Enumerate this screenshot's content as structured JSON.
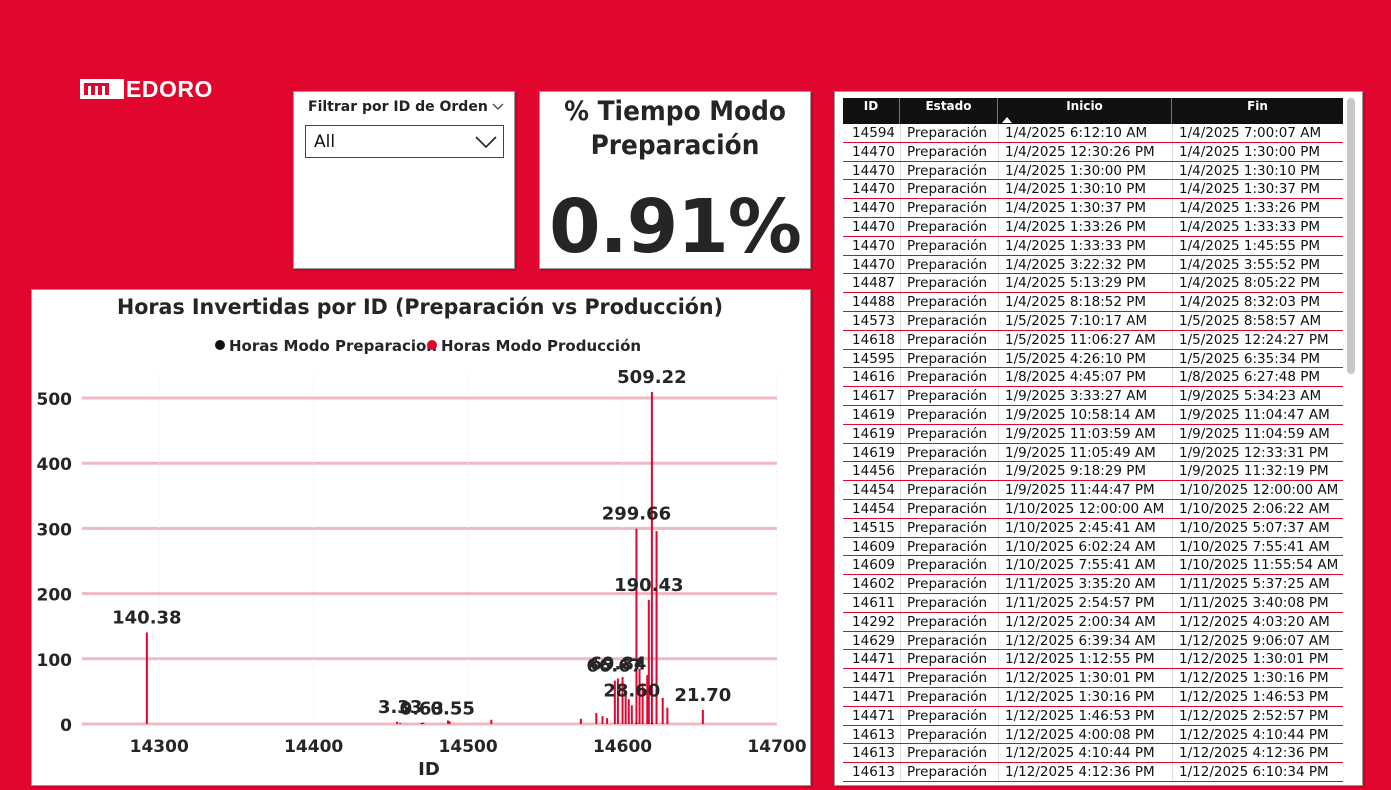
{
  "brand": {
    "logo_text": "EDORO"
  },
  "slicer": {
    "title": "Filtrar por ID de Orden",
    "selected": "All"
  },
  "kpi": {
    "title_line1": "% Tiempo Modo",
    "title_line2": "Preparación",
    "value": "0.91%"
  },
  "colors": {
    "background": "#E1062D",
    "series_prep": "#111111",
    "series_prod": "#E1062D",
    "grid": "#F0B8C2"
  },
  "chart_data": {
    "type": "bar",
    "title": "Horas Invertidas por ID (Preparación vs Producción)",
    "xlabel": "ID",
    "ylabel": "",
    "xlim": [
      14250,
      14700
    ],
    "ylim": [
      0,
      520
    ],
    "xticks": [
      14300,
      14400,
      14500,
      14600,
      14700
    ],
    "yticks": [
      0,
      100,
      200,
      300,
      400,
      500
    ],
    "grid": "horizontal",
    "legend_position": "top-center",
    "series": [
      {
        "name": "Horas Modo Preparacion",
        "color": "#111111",
        "x": [
          14470,
          14609,
          14619
        ],
        "values": [
          0.5,
          0.8,
          0.6
        ]
      },
      {
        "name": "Horas Modo Producción",
        "color": "#E1062D",
        "x": [
          14292,
          14454,
          14456,
          14470,
          14471,
          14487,
          14488,
          14515,
          14573,
          14583,
          14587,
          14590,
          14595,
          14597,
          14600,
          14602,
          14604,
          14606,
          14609,
          14611,
          14613,
          14616,
          14617,
          14619,
          14622,
          14626,
          14629,
          14652
        ],
        "values": [
          140.38,
          3.33,
          0.63,
          0.55,
          2.1,
          5.4,
          4.2,
          6.5,
          8.0,
          17.0,
          12.0,
          9.0,
          66.67,
          69.84,
          72.0,
          50.0,
          38.0,
          28.6,
          299.66,
          85.0,
          60.0,
          75.0,
          190.43,
          509.22,
          296.0,
          40.0,
          25.0,
          21.7
        ]
      }
    ],
    "data_labels": [
      {
        "x": 14292,
        "y": 140.38,
        "text": "140.38"
      },
      {
        "x": 14456,
        "y": 3.33,
        "text": "3.33"
      },
      {
        "x": 14470,
        "y": 0.63,
        "text": "0.63"
      },
      {
        "x": 14490,
        "y": 0.55,
        "text": "0.55"
      },
      {
        "x": 14595,
        "y": 66.67,
        "text": "66.67"
      },
      {
        "x": 14597,
        "y": 69.84,
        "text": "69.84"
      },
      {
        "x": 14606,
        "y": 28.6,
        "text": "28.60"
      },
      {
        "x": 14609,
        "y": 299.66,
        "text": "299.66"
      },
      {
        "x": 14617,
        "y": 190.43,
        "text": "190.43"
      },
      {
        "x": 14619,
        "y": 509.22,
        "text": "509.22"
      },
      {
        "x": 14652,
        "y": 21.7,
        "text": "21.70"
      }
    ]
  },
  "table": {
    "columns": [
      "ID",
      "Estado",
      "Inicio",
      "Fin"
    ],
    "rows": [
      [
        "14594",
        "Preparación",
        "1/4/2025 6:12:10 AM",
        "1/4/2025 7:00:07 AM"
      ],
      [
        "14470",
        "Preparación",
        "1/4/2025 12:30:26 PM",
        "1/4/2025 1:30:00 PM"
      ],
      [
        "14470",
        "Preparación",
        "1/4/2025 1:30:00 PM",
        "1/4/2025 1:30:10 PM"
      ],
      [
        "14470",
        "Preparación",
        "1/4/2025 1:30:10 PM",
        "1/4/2025 1:30:37 PM"
      ],
      [
        "14470",
        "Preparación",
        "1/4/2025 1:30:37 PM",
        "1/4/2025 1:33:26 PM"
      ],
      [
        "14470",
        "Preparación",
        "1/4/2025 1:33:26 PM",
        "1/4/2025 1:33:33 PM"
      ],
      [
        "14470",
        "Preparación",
        "1/4/2025 1:33:33 PM",
        "1/4/2025 1:45:55 PM"
      ],
      [
        "14470",
        "Preparación",
        "1/4/2025 3:22:32 PM",
        "1/4/2025 3:55:52 PM"
      ],
      [
        "14487",
        "Preparación",
        "1/4/2025 5:13:29 PM",
        "1/4/2025 8:05:22 PM"
      ],
      [
        "14488",
        "Preparación",
        "1/4/2025 8:18:52 PM",
        "1/4/2025 8:32:03 PM"
      ],
      [
        "14573",
        "Preparación",
        "1/5/2025 7:10:17 AM",
        "1/5/2025 8:58:57 AM"
      ],
      [
        "14618",
        "Preparación",
        "1/5/2025 11:06:27 AM",
        "1/5/2025 12:24:27 PM"
      ],
      [
        "14595",
        "Preparación",
        "1/5/2025 4:26:10 PM",
        "1/5/2025 6:35:34 PM"
      ],
      [
        "14616",
        "Preparación",
        "1/8/2025 4:45:07 PM",
        "1/8/2025 6:27:48 PM"
      ],
      [
        "14617",
        "Preparación",
        "1/9/2025 3:33:27 AM",
        "1/9/2025 5:34:23 AM"
      ],
      [
        "14619",
        "Preparación",
        "1/9/2025 10:58:14 AM",
        "1/9/2025 11:04:47 AM"
      ],
      [
        "14619",
        "Preparación",
        "1/9/2025 11:03:59 AM",
        "1/9/2025 11:04:59 AM"
      ],
      [
        "14619",
        "Preparación",
        "1/9/2025 11:05:49 AM",
        "1/9/2025 12:33:31 PM"
      ],
      [
        "14456",
        "Preparación",
        "1/9/2025 9:18:29 PM",
        "1/9/2025 11:32:19 PM"
      ],
      [
        "14454",
        "Preparación",
        "1/9/2025 11:44:47 PM",
        "1/10/2025 12:00:00 AM"
      ],
      [
        "14454",
        "Preparación",
        "1/10/2025 12:00:00 AM",
        "1/10/2025 2:06:22 AM"
      ],
      [
        "14515",
        "Preparación",
        "1/10/2025 2:45:41 AM",
        "1/10/2025 5:07:37 AM"
      ],
      [
        "14609",
        "Preparación",
        "1/10/2025 6:02:24 AM",
        "1/10/2025 7:55:41 AM"
      ],
      [
        "14609",
        "Preparación",
        "1/10/2025 7:55:41 AM",
        "1/10/2025 11:55:54 AM"
      ],
      [
        "14602",
        "Preparación",
        "1/11/2025 3:35:20 AM",
        "1/11/2025 5:37:25 AM"
      ],
      [
        "14611",
        "Preparación",
        "1/11/2025 2:54:57 PM",
        "1/11/2025 3:40:08 PM"
      ],
      [
        "14292",
        "Preparación",
        "1/12/2025 2:00:34 AM",
        "1/12/2025 4:03:20 AM"
      ],
      [
        "14629",
        "Preparación",
        "1/12/2025 6:39:34 AM",
        "1/12/2025 9:06:07 AM"
      ],
      [
        "14471",
        "Preparación",
        "1/12/2025 1:12:55 PM",
        "1/12/2025 1:30:01 PM"
      ],
      [
        "14471",
        "Preparación",
        "1/12/2025 1:30:01 PM",
        "1/12/2025 1:30:16 PM"
      ],
      [
        "14471",
        "Preparación",
        "1/12/2025 1:30:16 PM",
        "1/12/2025 1:46:53 PM"
      ],
      [
        "14471",
        "Preparación",
        "1/12/2025 1:46:53 PM",
        "1/12/2025 2:52:57 PM"
      ],
      [
        "14613",
        "Preparación",
        "1/12/2025 4:00:08 PM",
        "1/12/2025 4:10:44 PM"
      ],
      [
        "14613",
        "Preparación",
        "1/12/2025 4:10:44 PM",
        "1/12/2025 4:12:36 PM"
      ],
      [
        "14613",
        "Preparación",
        "1/12/2025 4:12:36 PM",
        "1/12/2025 6:10:34 PM"
      ]
    ]
  }
}
